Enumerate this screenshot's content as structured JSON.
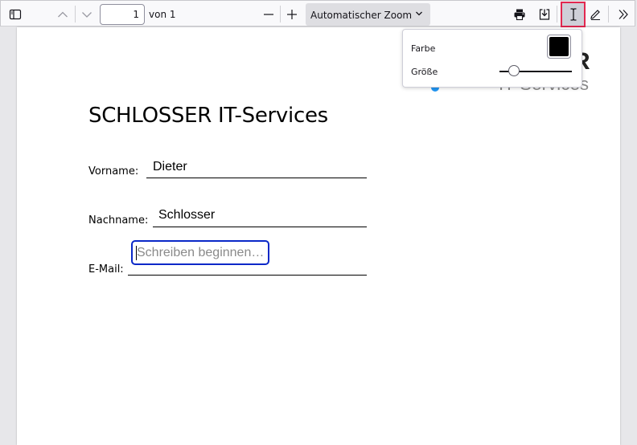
{
  "toolbar": {
    "page_current": "1",
    "page_total": "von 1",
    "zoom_value": "Automatischer Zoom"
  },
  "document": {
    "title": "SCHLOSSER IT-Services",
    "logo_letter": "R",
    "logo_text": "IT-Services",
    "fields": [
      {
        "label": "Vorname:",
        "value": "Dieter"
      },
      {
        "label": "Nachname:",
        "value": "Schlosser"
      },
      {
        "label": "E-Mail:",
        "value": ""
      }
    ],
    "textbox_placeholder": "Schreiben beginnen…"
  },
  "editor_popup": {
    "color_label": "Farbe",
    "size_label": "Größe",
    "color_value": "#000000",
    "size_level": 0.15
  },
  "colors": {
    "highlight_border": "#e22850",
    "textbox_border": "#0a28c8",
    "logo_blue": "#2196f3"
  }
}
